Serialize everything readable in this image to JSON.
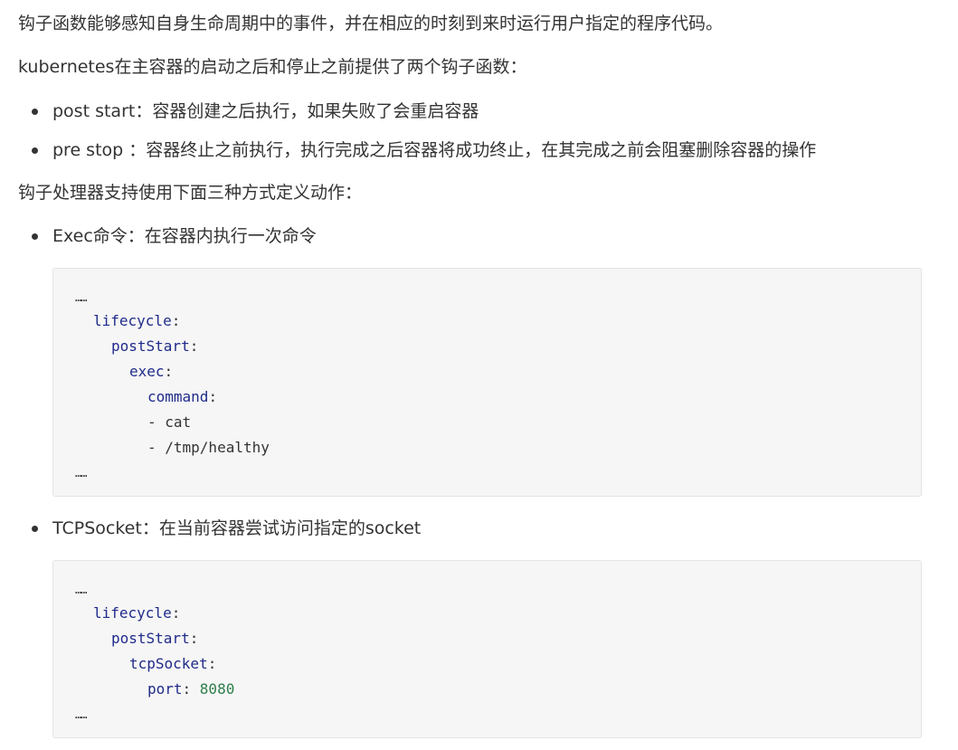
{
  "paragraphs": {
    "intro": "钩子函数能够感知自身生命周期中的事件，并在相应的时刻到来时运行用户指定的程序代码。",
    "k8s_hooks": "kubernetes在主容器的启动之后和停止之前提供了两个钩子函数：",
    "handlers": "钩子处理器支持使用下面三种方式定义动作："
  },
  "hooks": [
    {
      "text": "post start：容器创建之后执行，如果失败了会重启容器"
    },
    {
      "text": "pre stop ：容器终止之前执行，执行完成之后容器将成功终止，在其完成之前会阻塞删除容器的操作"
    }
  ],
  "exec_item": "Exec命令：在容器内执行一次命令",
  "exec_code": {
    "ellipsis_top": "……",
    "lifecycle": "lifecycle",
    "postStart": "postStart",
    "exec": "exec",
    "command": "command",
    "cmd1": "- cat",
    "cmd2": "- /tmp/healthy",
    "ellipsis_bottom": "……"
  },
  "tcp_item": "TCPSocket：在当前容器尝试访问指定的socket",
  "tcp_code": {
    "ellipsis_top": "……",
    "lifecycle": "lifecycle",
    "postStart": "postStart",
    "tcpSocket": "tcpSocket",
    "port_key": "port",
    "port_value": "8080",
    "ellipsis_bottom": "……"
  }
}
